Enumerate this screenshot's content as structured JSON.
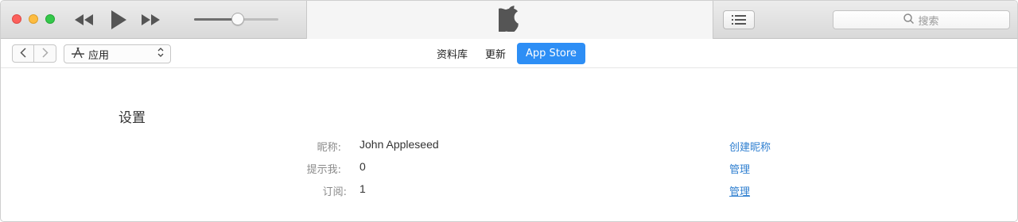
{
  "toolbar": {
    "search_placeholder": "搜索"
  },
  "playback": {
    "volume_level": 0.52
  },
  "nav": {
    "media_kind": "应用",
    "tabs": [
      {
        "label": "资料库",
        "active": false
      },
      {
        "label": "更新",
        "active": false
      },
      {
        "label": "App Store",
        "active": true
      }
    ]
  },
  "settings": {
    "title": "设置",
    "rows": [
      {
        "label": "昵称:",
        "value": "John Appleseed",
        "action": "创建昵称"
      },
      {
        "label": "提示我:",
        "value": "0",
        "action": "管理"
      },
      {
        "label": "订阅:",
        "value": "1",
        "action": "管理"
      }
    ]
  },
  "colors": {
    "accent": "#2d8ef5",
    "link": "#2f7fd0"
  },
  "icons": [
    "rewind-icon",
    "play-icon",
    "fast-forward-icon",
    "apple-logo-icon",
    "list-icon",
    "search-icon",
    "chevron-left-icon",
    "chevron-right-icon",
    "app-store-icon",
    "updown-chevron-icon"
  ]
}
